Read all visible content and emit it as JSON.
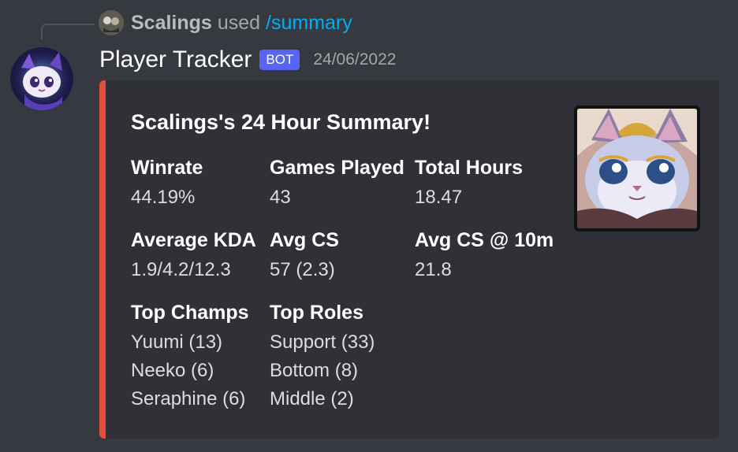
{
  "reply": {
    "username": "Scalings",
    "used_text": "used",
    "command": "/summary"
  },
  "message": {
    "author": "Player Tracker",
    "tag": "BOT",
    "timestamp": "24/06/2022"
  },
  "embed": {
    "accent_color": "#e44f3a",
    "title": "Scalings's 24 Hour Summary!",
    "fields": [
      {
        "name": "Winrate",
        "value": "44.19%"
      },
      {
        "name": "Games Played",
        "value": "43"
      },
      {
        "name": "Total Hours",
        "value": "18.47"
      },
      {
        "name": "Average KDA",
        "value": "1.9/4.2/12.3"
      },
      {
        "name": "Avg CS",
        "value": "57 (2.3)"
      },
      {
        "name": "Avg CS @ 10m",
        "value": "21.8"
      },
      {
        "name": "Top Champs",
        "lines": [
          "Yuumi (13)",
          "Neeko (6)",
          "Seraphine (6)"
        ]
      },
      {
        "name": "Top Roles",
        "lines": [
          "Support (33)",
          "Bottom (8)",
          "Middle (2)"
        ]
      }
    ]
  }
}
